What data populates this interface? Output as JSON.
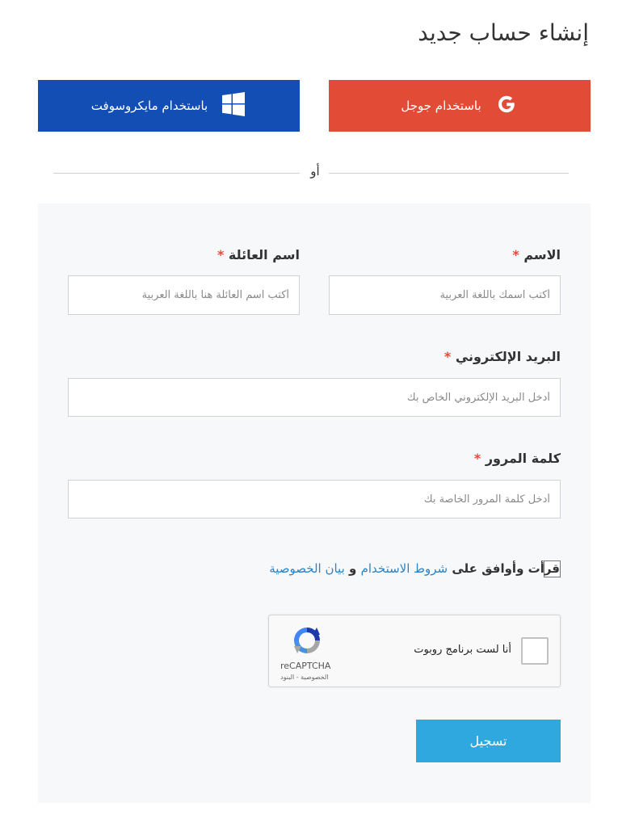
{
  "page": {
    "title": "إنشاء حساب جديد"
  },
  "social": {
    "google_label": "باستخدام جوجل",
    "microsoft_label": "باستخدام مايكروسوفت",
    "separator_text": "أو"
  },
  "form": {
    "first_name": {
      "label": "الاسم",
      "required_mark": "*",
      "placeholder": "أكتب اسمك باللغة العربية"
    },
    "last_name": {
      "label": "اسم العائلة",
      "required_mark": "*",
      "placeholder": "أكتب اسم العائلة هنا باللغة العربية"
    },
    "email": {
      "label": "البريد الإلكتروني",
      "required_mark": "*",
      "placeholder": "أدخل البريد الإلكتروني الخاص بك"
    },
    "password": {
      "label": "كلمة المرور",
      "required_mark": "*",
      "placeholder": "أدخل كلمة المرور الخاصة بك"
    },
    "terms": {
      "prefix": "قرأت وأوافق على",
      "terms_link": "شروط الاستخدام",
      "conjunction": "و",
      "privacy_link": "بيان الخصوصية"
    },
    "captcha": {
      "text": "أنا لست برنامج روبوت",
      "brand": "reCAPTCHA",
      "links": "الخصوصية - البنود"
    },
    "submit_label": "تسجيل"
  },
  "colors": {
    "google": "#e24c37",
    "microsoft": "#124eb3",
    "submit": "#2fa8df",
    "link": "#2b83c6",
    "required": "#e24c37"
  }
}
